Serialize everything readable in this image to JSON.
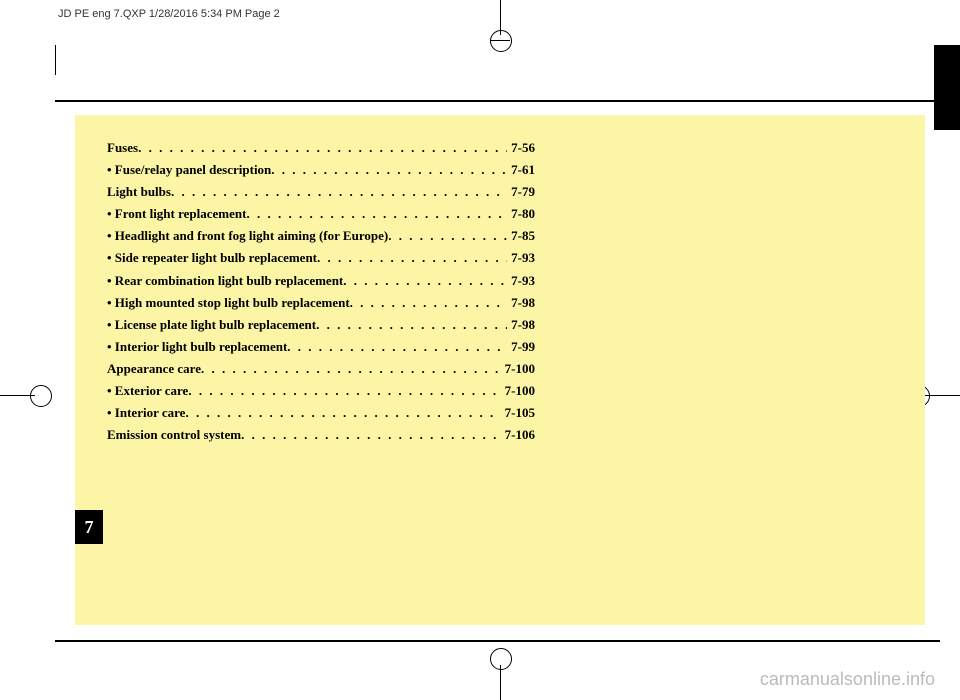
{
  "header": {
    "file_info": "JD PE eng 7.QXP  1/28/2016  5:34 PM  Page 2"
  },
  "chapter": {
    "number": "7"
  },
  "toc": [
    {
      "type": "main",
      "label": "Fuses",
      "page": "7-56"
    },
    {
      "type": "sub",
      "label": "• Fuse/relay panel description",
      "page": "7-61"
    },
    {
      "type": "main",
      "label": "Light bulbs",
      "page": "7-79"
    },
    {
      "type": "sub",
      "label": "• Front light replacement",
      "page": "7-80"
    },
    {
      "type": "sub",
      "label": "• Headlight and front fog light aiming (for Europe)",
      "page": "7-85"
    },
    {
      "type": "sub",
      "label": "• Side repeater light bulb replacement",
      "page": "7-93"
    },
    {
      "type": "sub",
      "label": "• Rear combination light bulb replacement",
      "page": "7-93"
    },
    {
      "type": "sub",
      "label": "• High mounted stop light bulb replacement",
      "page": "7-98"
    },
    {
      "type": "sub",
      "label": "• License plate light bulb replacement",
      "page": "7-98"
    },
    {
      "type": "sub",
      "label": "• Interior light bulb replacement",
      "page": "7-99"
    },
    {
      "type": "main",
      "label": "Appearance care",
      "page": "7-100"
    },
    {
      "type": "sub",
      "label": "• Exterior care",
      "page": "7-100"
    },
    {
      "type": "sub",
      "label": "• Interior care",
      "page": "7-105"
    },
    {
      "type": "main",
      "label": "Emission control system",
      "page": "7-106"
    }
  ],
  "watermark": "carmanualsonline.info"
}
